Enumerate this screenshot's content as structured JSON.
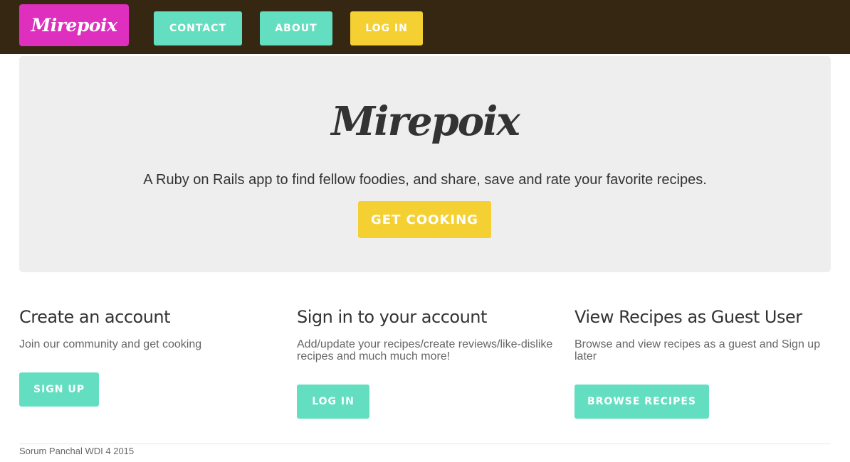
{
  "navbar": {
    "brand": "Mirepoix",
    "contact_label": "CONTACT",
    "about_label": "ABOUT",
    "login_label": "LOG IN"
  },
  "hero": {
    "title": "Mirepoix",
    "subtitle": "A Ruby on Rails app to find fellow foodies, and share, save and rate your favorite recipes.",
    "cta_label": "GET COOKING"
  },
  "columns": [
    {
      "title": "Create an account",
      "text": "Join our community and get cooking",
      "button_label": "SIGN UP"
    },
    {
      "title": "Sign in to your account",
      "text": "Add/update your recipes/create reviews/like-dislike recipes and much much more!",
      "button_label": "LOG IN"
    },
    {
      "title": "View Recipes as Guest User",
      "text": "Browse and view recipes as a guest and Sign up later",
      "button_label": "BROWSE RECIPES"
    }
  ],
  "footer": {
    "text": "Sorum Panchal WDI 4 2015"
  },
  "colors": {
    "navbar_bg": "#362713",
    "brand_bg": "#df2fbe",
    "teal": "#64dec1",
    "yellow": "#f5d033",
    "jumbotron_bg": "#eeeeee"
  }
}
